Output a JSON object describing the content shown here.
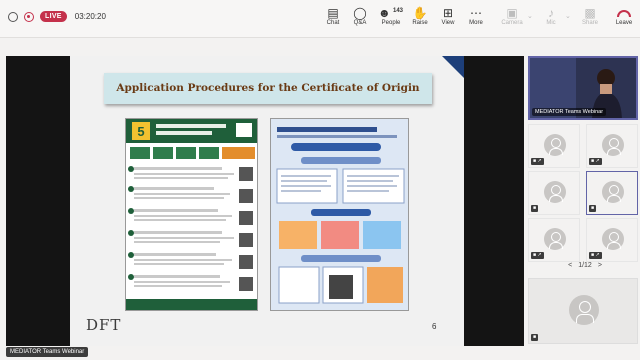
{
  "meeting": {
    "live_label": "LIVE",
    "elapsed": "03:20:20"
  },
  "toolbar": {
    "chat": "Chat",
    "qna": "Q&A",
    "people": "People",
    "people_count": "143",
    "raise": "Raise",
    "view": "View",
    "more": "More",
    "camera": "Camera",
    "mic": "Mic",
    "share": "Share",
    "leave": "Leave"
  },
  "stage": {
    "slide_title": "Application Procedures for the Certificate of Origin",
    "slide_logo": "DFT",
    "slide_page": "6",
    "presenter_label": "MEDIATOR Teams Webinar"
  },
  "gallery": {
    "presenter_label": "MEDIATOR Teams Webinar",
    "page_indicator": "1/12",
    "prev": "<",
    "next": ">"
  },
  "colors": {
    "accent": "#6264a7",
    "live": "#c4314b",
    "leave": "#c4314b",
    "banner": "#cfe6ea",
    "banner_text": "#6a3a14"
  },
  "icons": {
    "chat": "chat-icon",
    "qna": "qna-icon",
    "people": "people-icon",
    "raise": "raise-hand-icon",
    "view": "view-grid-icon",
    "more": "more-dots-icon",
    "camera": "camera-off-icon",
    "mic": "mic-off-icon",
    "share": "share-screen-icon",
    "leave": "leave-phone-icon"
  }
}
